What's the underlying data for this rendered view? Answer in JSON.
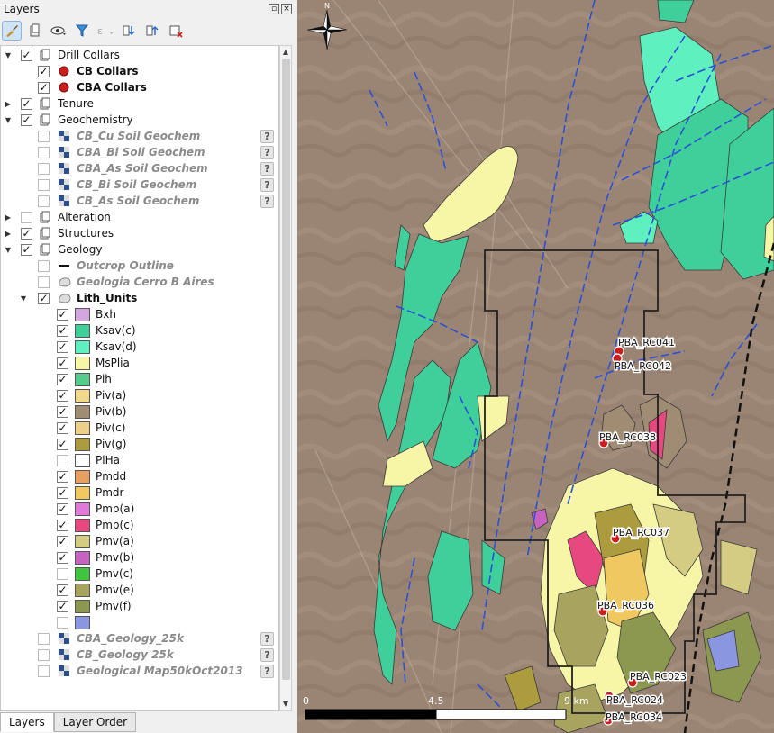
{
  "panel": {
    "title": "Layers",
    "tabs": [
      "Layers",
      "Layer Order"
    ]
  },
  "layers": [
    {
      "label": "Drill Collars",
      "checked": true,
      "expander": "open",
      "icon": "group-folder-icon",
      "indent": 0,
      "style": "normal"
    },
    {
      "label": "CB Collars",
      "checked": true,
      "icon": "red-dot-icon",
      "indent": 1,
      "style": "bold"
    },
    {
      "label": "CBA Collars",
      "checked": true,
      "icon": "red-dot-icon",
      "indent": 1,
      "style": "bold"
    },
    {
      "label": "Tenure",
      "checked": true,
      "expander": "closed",
      "icon": "group-folder-icon",
      "indent": 0,
      "style": "normal"
    },
    {
      "label": "Geochemistry",
      "checked": true,
      "expander": "open",
      "icon": "group-folder-icon",
      "indent": 0,
      "style": "normal"
    },
    {
      "label": "CB_Cu Soil Geochem",
      "checked": false,
      "icon": "raster-icon",
      "indent": 1,
      "style": "italic",
      "help": true
    },
    {
      "label": "CBA_Bi Soil Geochem",
      "checked": false,
      "icon": "raster-icon",
      "indent": 1,
      "style": "italic",
      "help": true
    },
    {
      "label": "CBA_As Soil Geochem",
      "checked": false,
      "icon": "raster-icon",
      "indent": 1,
      "style": "italic",
      "help": true
    },
    {
      "label": "CB_Bi Soil Geochem",
      "checked": false,
      "icon": "raster-icon",
      "indent": 1,
      "style": "italic",
      "help": true
    },
    {
      "label": "CB_As Soil Geochem",
      "checked": false,
      "icon": "raster-icon",
      "indent": 1,
      "style": "italic",
      "help": true
    },
    {
      "label": "Alteration",
      "checked": false,
      "expander": "closed",
      "icon": "group-folder-icon",
      "indent": 0,
      "style": "normal"
    },
    {
      "label": "Structures",
      "checked": true,
      "expander": "closed",
      "icon": "group-folder-icon",
      "indent": 0,
      "style": "normal"
    },
    {
      "label": "Geology",
      "checked": true,
      "expander": "open",
      "icon": "group-folder-icon",
      "indent": 0,
      "style": "normal"
    },
    {
      "label": "Outcrop Outline",
      "checked": false,
      "icon": "line-icon",
      "indent": 1,
      "style": "italic"
    },
    {
      "label": "Geologia Cerro B Aires",
      "checked": false,
      "icon": "polygon-icon",
      "indent": 1,
      "style": "italic"
    },
    {
      "label": "Lith_Units",
      "checked": true,
      "expander": "open",
      "icon": "polygon-icon",
      "indent": 1,
      "style": "bold"
    },
    {
      "label": "Bxh",
      "checked": true,
      "swatch": "#d4a6e0",
      "indent": 2,
      "style": "normal"
    },
    {
      "label": "Ksav(c)",
      "checked": true,
      "swatch": "#3fcf9a",
      "indent": 2,
      "style": "normal"
    },
    {
      "label": "Ksav(d)",
      "checked": true,
      "swatch": "#5ff0c0",
      "indent": 2,
      "style": "normal"
    },
    {
      "label": "MsPlia",
      "checked": true,
      "swatch": "#f7f5a6",
      "indent": 2,
      "style": "normal"
    },
    {
      "label": "Pih",
      "checked": true,
      "swatch": "#55cc8c",
      "indent": 2,
      "style": "normal"
    },
    {
      "label": "Piv(a)",
      "checked": true,
      "swatch": "#f2d98a",
      "indent": 2,
      "style": "normal"
    },
    {
      "label": "Piv(b)",
      "checked": true,
      "swatch": "#a08c72",
      "indent": 2,
      "style": "normal"
    },
    {
      "label": "Piv(c)",
      "checked": true,
      "swatch": "#ecd08a",
      "indent": 2,
      "style": "normal"
    },
    {
      "label": "Piv(g)",
      "checked": true,
      "swatch": "#ad9c3e",
      "indent": 2,
      "style": "normal"
    },
    {
      "label": "PlHa",
      "checked": false,
      "swatch": "#ffffff",
      "indent": 2,
      "style": "normal"
    },
    {
      "label": "Pmdd",
      "checked": true,
      "swatch": "#e8a060",
      "indent": 2,
      "style": "normal"
    },
    {
      "label": "Pmdr",
      "checked": true,
      "swatch": "#f0c860",
      "indent": 2,
      "style": "normal"
    },
    {
      "label": "Pmp(a)",
      "checked": true,
      "swatch": "#e07ad8",
      "indent": 2,
      "style": "normal"
    },
    {
      "label": "Pmp(c)",
      "checked": true,
      "swatch": "#e84880",
      "indent": 2,
      "style": "normal"
    },
    {
      "label": "Pmv(a)",
      "checked": true,
      "swatch": "#d4cc82",
      "indent": 2,
      "style": "normal"
    },
    {
      "label": "Pmv(b)",
      "checked": true,
      "swatch": "#c862c0",
      "indent": 2,
      "style": "normal"
    },
    {
      "label": "Pmv(c)",
      "checked": false,
      "swatch": "#3ec43e",
      "indent": 2,
      "style": "normal"
    },
    {
      "label": "Pmv(e)",
      "checked": true,
      "swatch": "#a8a460",
      "indent": 2,
      "style": "normal"
    },
    {
      "label": "Pmv(f)",
      "checked": true,
      "swatch": "#8c9850",
      "indent": 2,
      "style": "normal"
    },
    {
      "label": "",
      "checked": false,
      "swatch": "#8a96e0",
      "indent": 2,
      "style": "normal"
    },
    {
      "label": "CBA_Geology_25k",
      "checked": false,
      "icon": "raster-icon",
      "indent": 1,
      "style": "italic",
      "help": true
    },
    {
      "label": "CB_Geology 25k",
      "checked": false,
      "icon": "raster-icon",
      "indent": 1,
      "style": "italic",
      "help": true
    },
    {
      "label": "Geological Map50kOct2013",
      "checked": false,
      "icon": "raster-icon",
      "indent": 1,
      "style": "italic",
      "help": true
    }
  ],
  "map": {
    "north_label": "N",
    "scale": {
      "labels": [
        "0",
        "4.5",
        "9 km"
      ]
    },
    "drillholes": [
      "PBA_RC041",
      "PBA_RC042",
      "PBA_RC038",
      "PBA_RC037",
      "PBA_RC036",
      "PBA_RC023",
      "PBA_RC024",
      "PBA_RC034"
    ],
    "colors": {
      "terrain": "#9b8575",
      "fault": "#2a4fd8",
      "tenure_outline": "#222222",
      "collar": "#c81e1e"
    }
  }
}
